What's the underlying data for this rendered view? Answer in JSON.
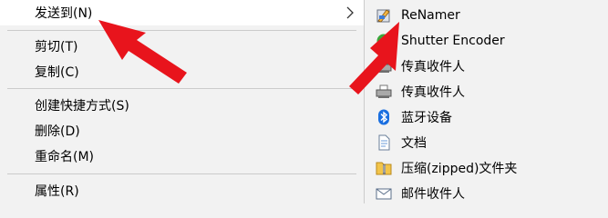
{
  "context_menu": {
    "items": [
      {
        "label": "发送到(N)"
      },
      {
        "label": "剪切(T)"
      },
      {
        "label": "复制(C)"
      },
      {
        "label": "创建快捷方式(S)"
      },
      {
        "label": "删除(D)"
      },
      {
        "label": "重命名(M)"
      },
      {
        "label": "属性(R)"
      }
    ]
  },
  "send_to_menu": {
    "items": [
      {
        "label": "ReNamer",
        "icon": "renamer-icon"
      },
      {
        "label": "Shutter Encoder",
        "icon": "shutter-encoder-icon"
      },
      {
        "label": "传真收件人",
        "icon": "fax-icon"
      },
      {
        "label": "传真收件人",
        "icon": "fax-icon"
      },
      {
        "label": "蓝牙设备",
        "icon": "bluetooth-icon"
      },
      {
        "label": "文档",
        "icon": "documents-icon"
      },
      {
        "label": "压缩(zipped)文件夹",
        "icon": "zip-folder-icon"
      },
      {
        "label": "邮件收件人",
        "icon": "mail-icon"
      }
    ]
  },
  "colors": {
    "menu_background": "#f2f2f2",
    "highlight": "#ffffff",
    "separator": "#cbcbcb",
    "annotation_arrow": "#e8141c"
  }
}
